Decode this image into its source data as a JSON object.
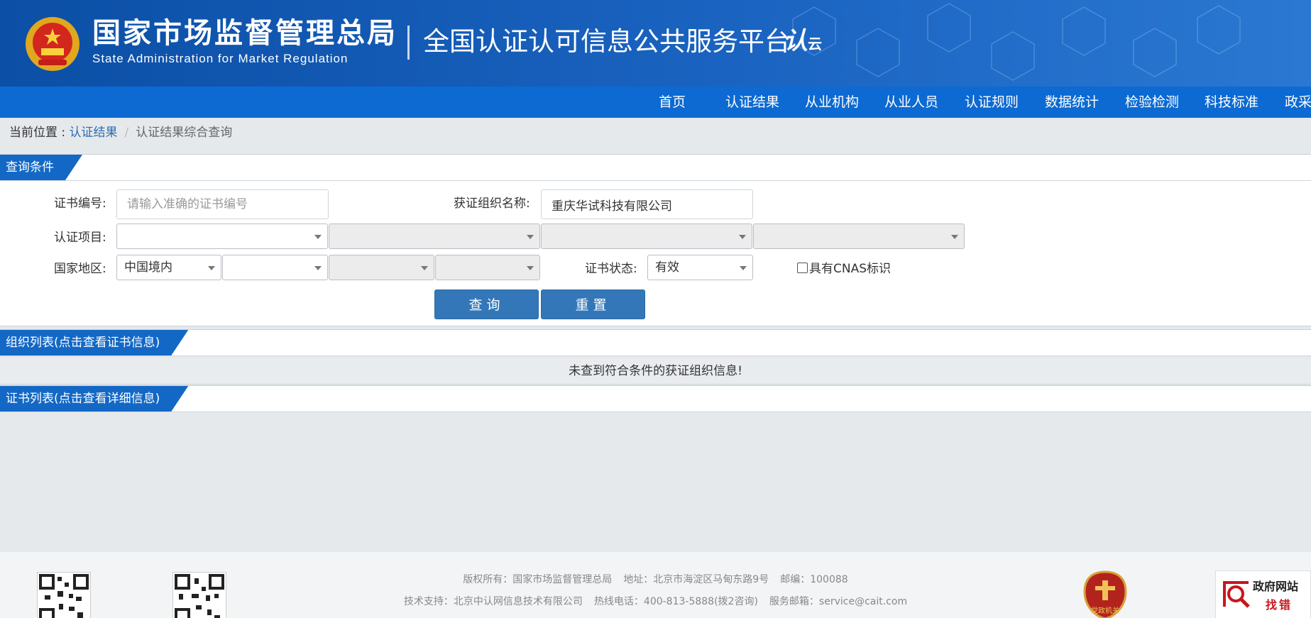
{
  "header": {
    "org_name_cn": "国家市场监督管理总局",
    "org_name_en": "State Administration  for  Market Regulation",
    "platform_title": "全国认证认可信息公共服务平台",
    "platform_mark": "认",
    "platform_mark_suffix": "云",
    "brand_blue": "#0b4fa6"
  },
  "nav": {
    "items": [
      "首页",
      "认证结果",
      "从业机构",
      "从业人员",
      "认证规则",
      "数据统计",
      "检验检测",
      "科技标准",
      "政采"
    ]
  },
  "breadcrumb": {
    "prefix": "当前位置 : ",
    "link": "认证结果",
    "separator": "/",
    "current": "认证结果综合查询"
  },
  "query": {
    "section_title": "查询条件",
    "cert_no_label": "证书编号:",
    "cert_no_placeholder": "请输入准确的证书编号",
    "org_name_label": "获证组织名称:",
    "org_name_value": "重庆华试科技有限公司",
    "cert_project_label": "认证项目:",
    "region_label": "国家地区:",
    "region_value": "中国境内",
    "status_label": "证书状态:",
    "status_value": "有效",
    "cnas_label": "具有CNAS标识",
    "search_button": "查询",
    "reset_button": "重置"
  },
  "org_list": {
    "section_title": "组织列表(点击查看证书信息)",
    "empty_message": "未查到符合条件的获证组织信息!"
  },
  "cert_list": {
    "section_title": "证书列表(点击查看详细信息)"
  },
  "footer": {
    "copyright": "版权所有：国家市场监督管理总局",
    "address": "地址：北京市海淀区马甸东路9号",
    "postcode": "邮编：100088",
    "tech_support": "技术支持：北京中认网信息技术有限公司",
    "hotline": "热线电话：400-813-5888(拨2咨询)",
    "email": "服务邮箱：service@cait.com",
    "party_badge": "党政机关",
    "gov_badge_top": "政府网站",
    "gov_badge_bottom": "找错"
  }
}
